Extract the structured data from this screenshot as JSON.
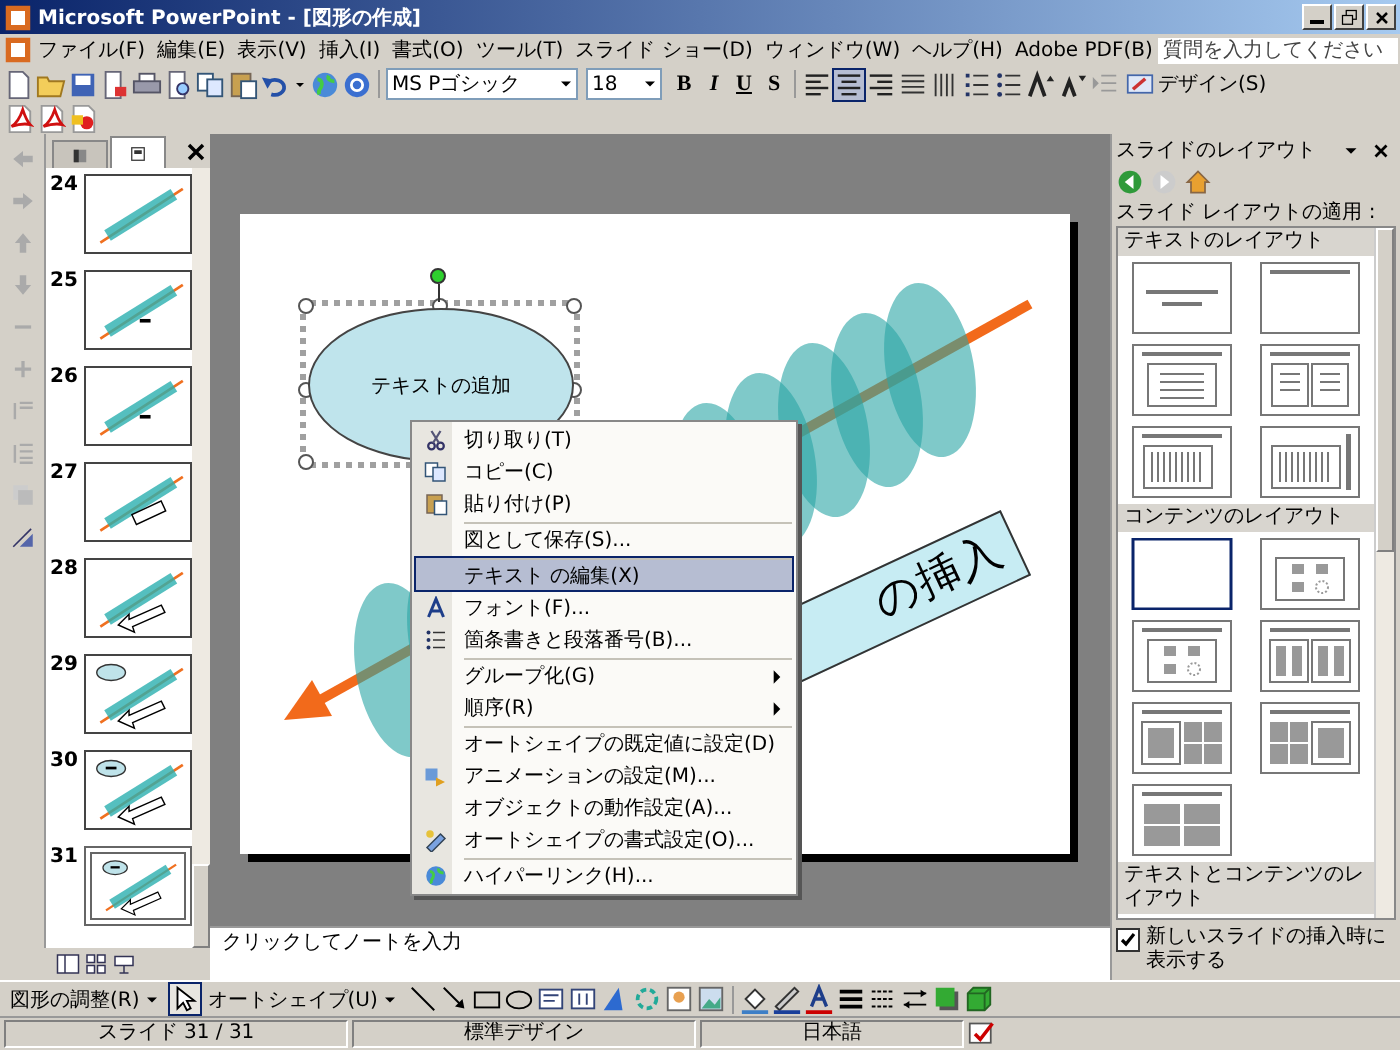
{
  "window": {
    "title": "Microsoft PowerPoint - [図形の作成]"
  },
  "menu_bar": {
    "items": [
      "ファイル(F)",
      "編集(E)",
      "表示(V)",
      "挿入(I)",
      "書式(O)",
      "ツール(T)",
      "スライド ショー(D)",
      "ウィンドウ(W)",
      "ヘルプ(H)",
      "Adobe PDF(B)"
    ],
    "help_field": {
      "placeholder": "質問を入力してください"
    }
  },
  "formatting_toolbar": {
    "font": "MS Pゴシック",
    "font_size": "18",
    "style_buttons": [
      "B",
      "I",
      "U",
      "S"
    ],
    "alignment": [
      {
        "selected": false
      },
      {
        "selected": true
      },
      {
        "selected": false
      }
    ],
    "design_button": "デザイン(S)"
  },
  "slide_pane": {
    "tabs": [
      {
        "selected": false
      },
      {
        "selected": true
      }
    ],
    "slides": [
      {
        "number": "24",
        "kind": "bar",
        "selected": false
      },
      {
        "number": "25",
        "kind": "bar-label",
        "selected": false
      },
      {
        "number": "26",
        "kind": "bar-label",
        "selected": false
      },
      {
        "number": "27",
        "kind": "bar-tag",
        "selected": false
      },
      {
        "number": "28",
        "kind": "bar-arrow",
        "selected": false
      },
      {
        "number": "29",
        "kind": "bar-arrow-oval",
        "selected": false
      },
      {
        "number": "30",
        "kind": "bar-arrow-oval-text",
        "selected": false
      },
      {
        "number": "31",
        "kind": "bar-arrow-oval-text",
        "selected": true
      }
    ]
  },
  "slide": {
    "shape_text": "テキストの追加",
    "banner_text": "の挿入"
  },
  "context_menu": {
    "items": [
      {
        "label": "切り取り(T)",
        "selected": false,
        "separator_before": false,
        "submenu": false
      },
      {
        "label": "コピー(C)",
        "selected": false,
        "separator_before": false,
        "submenu": false
      },
      {
        "label": "貼り付け(P)",
        "selected": false,
        "separator_before": false,
        "submenu": false
      },
      {
        "label": "図として保存(S)...",
        "selected": false,
        "separator_before": true,
        "submenu": false
      },
      {
        "label": "テキスト の編集(X)",
        "selected": true,
        "separator_before": true,
        "submenu": false
      },
      {
        "label": "フォント(F)...",
        "selected": false,
        "separator_before": false,
        "submenu": false
      },
      {
        "label": "箇条書きと段落番号(B)...",
        "selected": false,
        "separator_before": false,
        "submenu": false
      },
      {
        "label": "グループ化(G)",
        "selected": false,
        "separator_before": true,
        "submenu": true
      },
      {
        "label": "順序(R)",
        "selected": false,
        "separator_before": false,
        "submenu": true
      },
      {
        "label": "オートシェイプの既定値に設定(D)",
        "selected": false,
        "separator_before": true,
        "submenu": false
      },
      {
        "label": "アニメーションの設定(M)...",
        "selected": false,
        "separator_before": false,
        "submenu": false
      },
      {
        "label": "オブジェクトの動作設定(A)...",
        "selected": false,
        "separator_before": false,
        "submenu": false
      },
      {
        "label": "オートシェイプの書式設定(O)...",
        "selected": false,
        "separator_before": false,
        "submenu": false
      },
      {
        "label": "ハイパーリンク(H)...",
        "selected": false,
        "separator_before": true,
        "submenu": false
      }
    ]
  },
  "task_pane": {
    "title": "スライドのレイアウト",
    "subtitle": "スライド レイアウトの適用 :",
    "sections": [
      {
        "title": "テキストのレイアウト",
        "layouts": [
          {
            "kind": "title",
            "selected": false
          },
          {
            "kind": "title-only",
            "selected": false
          },
          {
            "kind": "title-text",
            "selected": false
          },
          {
            "kind": "title-two-text",
            "selected": false
          },
          {
            "kind": "title-vertical-text",
            "selected": false
          },
          {
            "kind": "vertical-title-text",
            "selected": false
          }
        ]
      },
      {
        "title": "コンテンツのレイアウト",
        "layouts": [
          {
            "kind": "blank",
            "selected": true
          },
          {
            "kind": "content",
            "selected": false
          },
          {
            "kind": "title-content",
            "selected": false
          },
          {
            "kind": "title-two-content",
            "selected": false
          },
          {
            "kind": "title-content-quad",
            "selected": false
          },
          {
            "kind": "title-quad-content",
            "selected": false
          },
          {
            "kind": "title-four-content",
            "selected": false
          }
        ]
      },
      {
        "title": "テキストとコンテンツのレイアウト"
      }
    ],
    "show_on_insert": {
      "label": "新しいスライドの挿入時に表示する",
      "checked": true
    }
  },
  "notes": {
    "placeholder": "クリックしてノートを入力"
  },
  "drawing_toolbar": {
    "draw_menu": "図形の調整(R)",
    "autoshapes_menu": "オートシェイプ(U)"
  },
  "status_bar": {
    "slide": "スライド 31 / 31",
    "design": "標準デザイン",
    "language": "日本語"
  }
}
